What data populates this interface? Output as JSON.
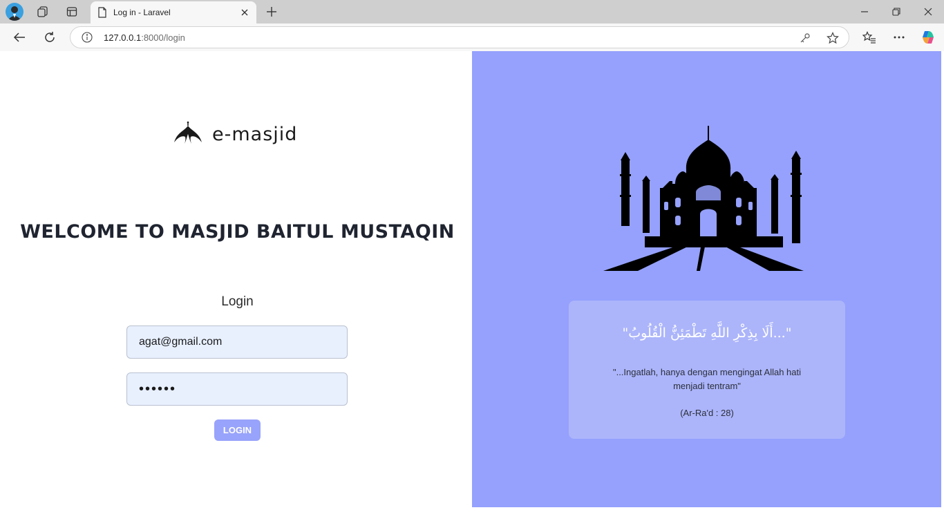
{
  "browser": {
    "tab_title": "Log in - Laravel",
    "url_host": "127.0.0.1",
    "url_path": ":8000/login",
    "icons": [
      "profile-avatar",
      "workspaces-icon",
      "tab-actions-icon",
      "page-icon",
      "close-icon",
      "new-tab-icon",
      "minimize-icon",
      "restore-icon",
      "close-window-icon",
      "back-icon",
      "refresh-icon",
      "info-icon",
      "key-icon",
      "star-icon",
      "favorites-icon",
      "more-icon",
      "copilot-icon"
    ]
  },
  "brand": {
    "name": "e-masjid"
  },
  "login": {
    "welcome": "WELCOME TO MASJID BAITUL MUSTAQIN",
    "title": "Login",
    "email_value": "agat@gmail.com",
    "password_value": "••••••",
    "button_label": "LOGIN"
  },
  "quote": {
    "arabic": "\"...أَلَا بِذِكْرِ اللَّهِ تَطْمَئِنُّ الْقُلُوبُ\"",
    "translation": "\"...Ingatlah, hanya dengan mengingat Allah hati menjadi tentram\"",
    "source": "(Ar-Ra'd : 28)"
  },
  "colors": {
    "right_panel": "#95a1fd",
    "card": "#acb5fa",
    "button": "#98a3fb",
    "input_bg": "#e8f0fe"
  }
}
